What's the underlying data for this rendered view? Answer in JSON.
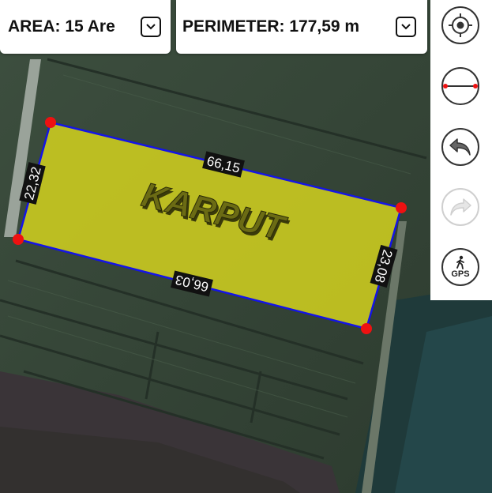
{
  "area_label": "AREA: 15 Are",
  "perimeter_label": "PERIMETER: 177,59 m",
  "parcel": {
    "name": "KARPUT",
    "side_top": "66,15",
    "side_bottom": "66,03",
    "side_left": "22,32",
    "side_right": "23,08"
  },
  "toolbar": {
    "locate": "crosshair-icon",
    "measure": "measure-line-icon",
    "undo": "undo-icon",
    "redo": "redo-icon",
    "gps_label": "GPS"
  },
  "colors": {
    "polygon_fill": "#d4d21e",
    "polygon_stroke": "#1414e6",
    "vertex": "#ee1111",
    "label_text": "#3a3a10"
  }
}
